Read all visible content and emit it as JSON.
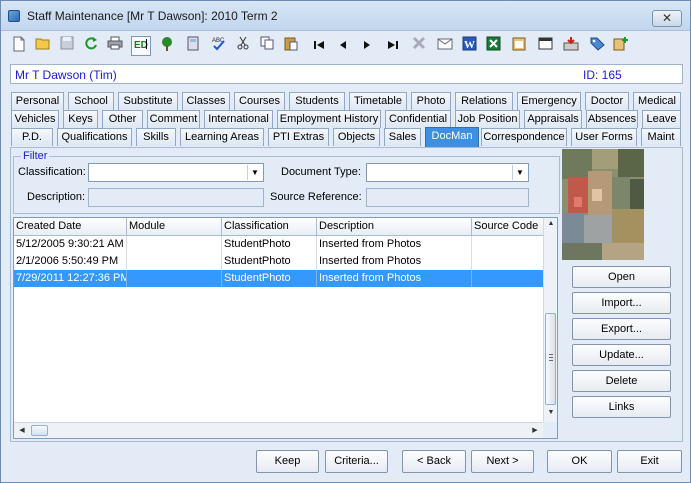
{
  "window": {
    "title": "Staff Maintenance  [Mr T Dawson]:  2010 Term 2",
    "close_label": "✕"
  },
  "toolbar": {
    "icons": [
      "new-icon",
      "open-folder-icon",
      "save-icon",
      "refresh-icon",
      "print-icon",
      "edit-icon",
      "tree-icon",
      "calculator-icon",
      "spellcheck-icon",
      "cut-icon",
      "copy-icon",
      "paste-icon",
      "first-record-icon",
      "previous-record-icon",
      "next-record-icon",
      "last-record-icon",
      "delete-icon",
      "email-icon",
      "word-icon",
      "excel-icon",
      "clipboard-icon",
      "calendar-icon",
      "import-icon",
      "tag-icon",
      "add-record-icon"
    ]
  },
  "staff": {
    "name": "Mr T Dawson (Tim)",
    "id_label": "ID: 165"
  },
  "tabs": {
    "row1": [
      "Personal",
      "School",
      "Substitute",
      "Classes",
      "Courses",
      "Students",
      "Timetable",
      "Photo",
      "Relations",
      "Emergency",
      "Doctor",
      "Medical"
    ],
    "row2": [
      "Vehicles",
      "Keys",
      "Other",
      "Comment",
      "International",
      "Employment History",
      "Confidential",
      "Job Position",
      "Appraisals",
      "Absences",
      "Leave"
    ],
    "row3": [
      "P.D.",
      "Qualifications",
      "Skills",
      "Learning Areas",
      "PTI Extras",
      "Objects",
      "Sales",
      "DocMan",
      "Correspondence",
      "User Forms",
      "Maint"
    ],
    "active": "DocMan"
  },
  "filter": {
    "legend": "Filter",
    "classification_label": "Classification:",
    "classification_value": "",
    "document_type_label": "Document Type:",
    "document_type_value": "",
    "description_label": "Description:",
    "description_value": "",
    "source_reference_label": "Source Reference:",
    "source_reference_value": ""
  },
  "grid": {
    "columns": [
      "Created Date",
      "Module",
      "Classification",
      "Description",
      "Source Code"
    ],
    "rows": [
      {
        "created": "5/12/2005 9:30:21 AM",
        "module": "",
        "classification": "StudentPhoto",
        "description": "Inserted from Photos",
        "source": ""
      },
      {
        "created": "2/1/2006 5:50:49 PM",
        "module": "",
        "classification": "StudentPhoto",
        "description": "Inserted from Photos",
        "source": ""
      },
      {
        "created": "7/29/2011 12:27:36 PM",
        "module": "",
        "classification": "StudentPhoto",
        "description": "Inserted from Photos",
        "source": ""
      }
    ],
    "selected_row": 2
  },
  "side_buttons": {
    "open": "Open",
    "import": "Import...",
    "export": "Export...",
    "update": "Update...",
    "delete": "Delete",
    "links": "Links"
  },
  "bottom_buttons": {
    "keep": "Keep",
    "criteria": "Criteria...",
    "back": "< Back",
    "next": "Next >",
    "ok": "OK",
    "exit": "Exit"
  },
  "colors": {
    "accent_blue_text": "#1a1ad0",
    "active_tab": "#3d8fe0",
    "selected_row": "#3399ff"
  }
}
